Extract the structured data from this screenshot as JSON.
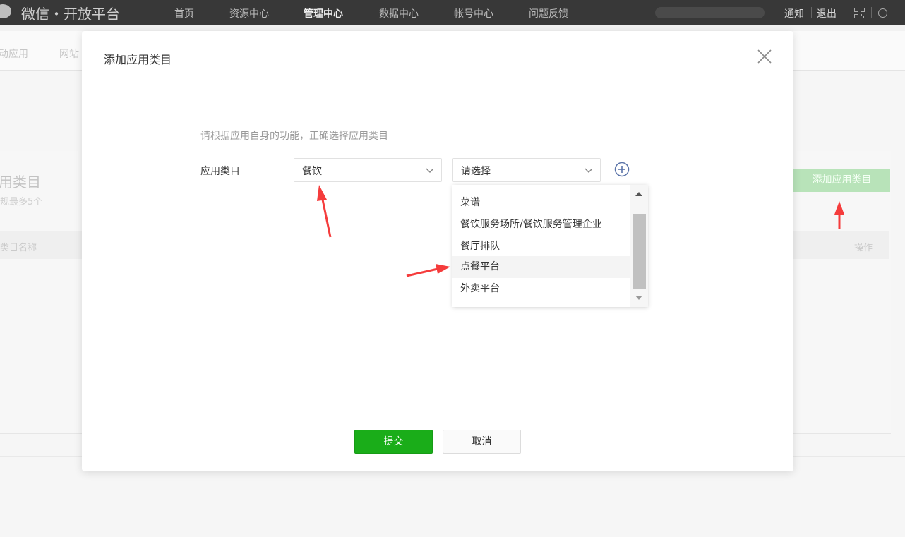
{
  "top_bar": {
    "brand": "微信・开放平台",
    "nav": [
      "首页",
      "资源中心",
      "管理中心",
      "数据中心",
      "帐号中心",
      "问题反馈"
    ],
    "active_nav": "管理中心",
    "right_links": [
      "通知",
      "退出"
    ]
  },
  "sub_nav": [
    "动应用",
    "网站"
  ],
  "background": {
    "heading": "用类目",
    "subheading": "规最多5个",
    "table_headers": [
      "类目名称",
      "操作"
    ],
    "add_button": "添加应用类目"
  },
  "dialog": {
    "title": "添加应用类目",
    "hint": "请根据应用自身的功能，正确选择应用类目",
    "field_label": "应用类目",
    "select_primary": "餐饮",
    "select_secondary": "请选择",
    "dropdown_options": [
      "菜谱",
      "餐饮服务场所/餐饮服务管理企业",
      "餐厅排队",
      "点餐平台",
      "外卖平台"
    ],
    "hovered_option": "点餐平台",
    "submit": "提交",
    "cancel": "取消"
  },
  "colors": {
    "primary_green": "#1aad19",
    "annotation_red": "#f53c3c",
    "top_bar": "#383838"
  },
  "icons": [
    "close-icon",
    "chevron-down-icon",
    "plus-circle-icon",
    "qr-code-icon",
    "globe-icon",
    "arrow-annotation"
  ]
}
